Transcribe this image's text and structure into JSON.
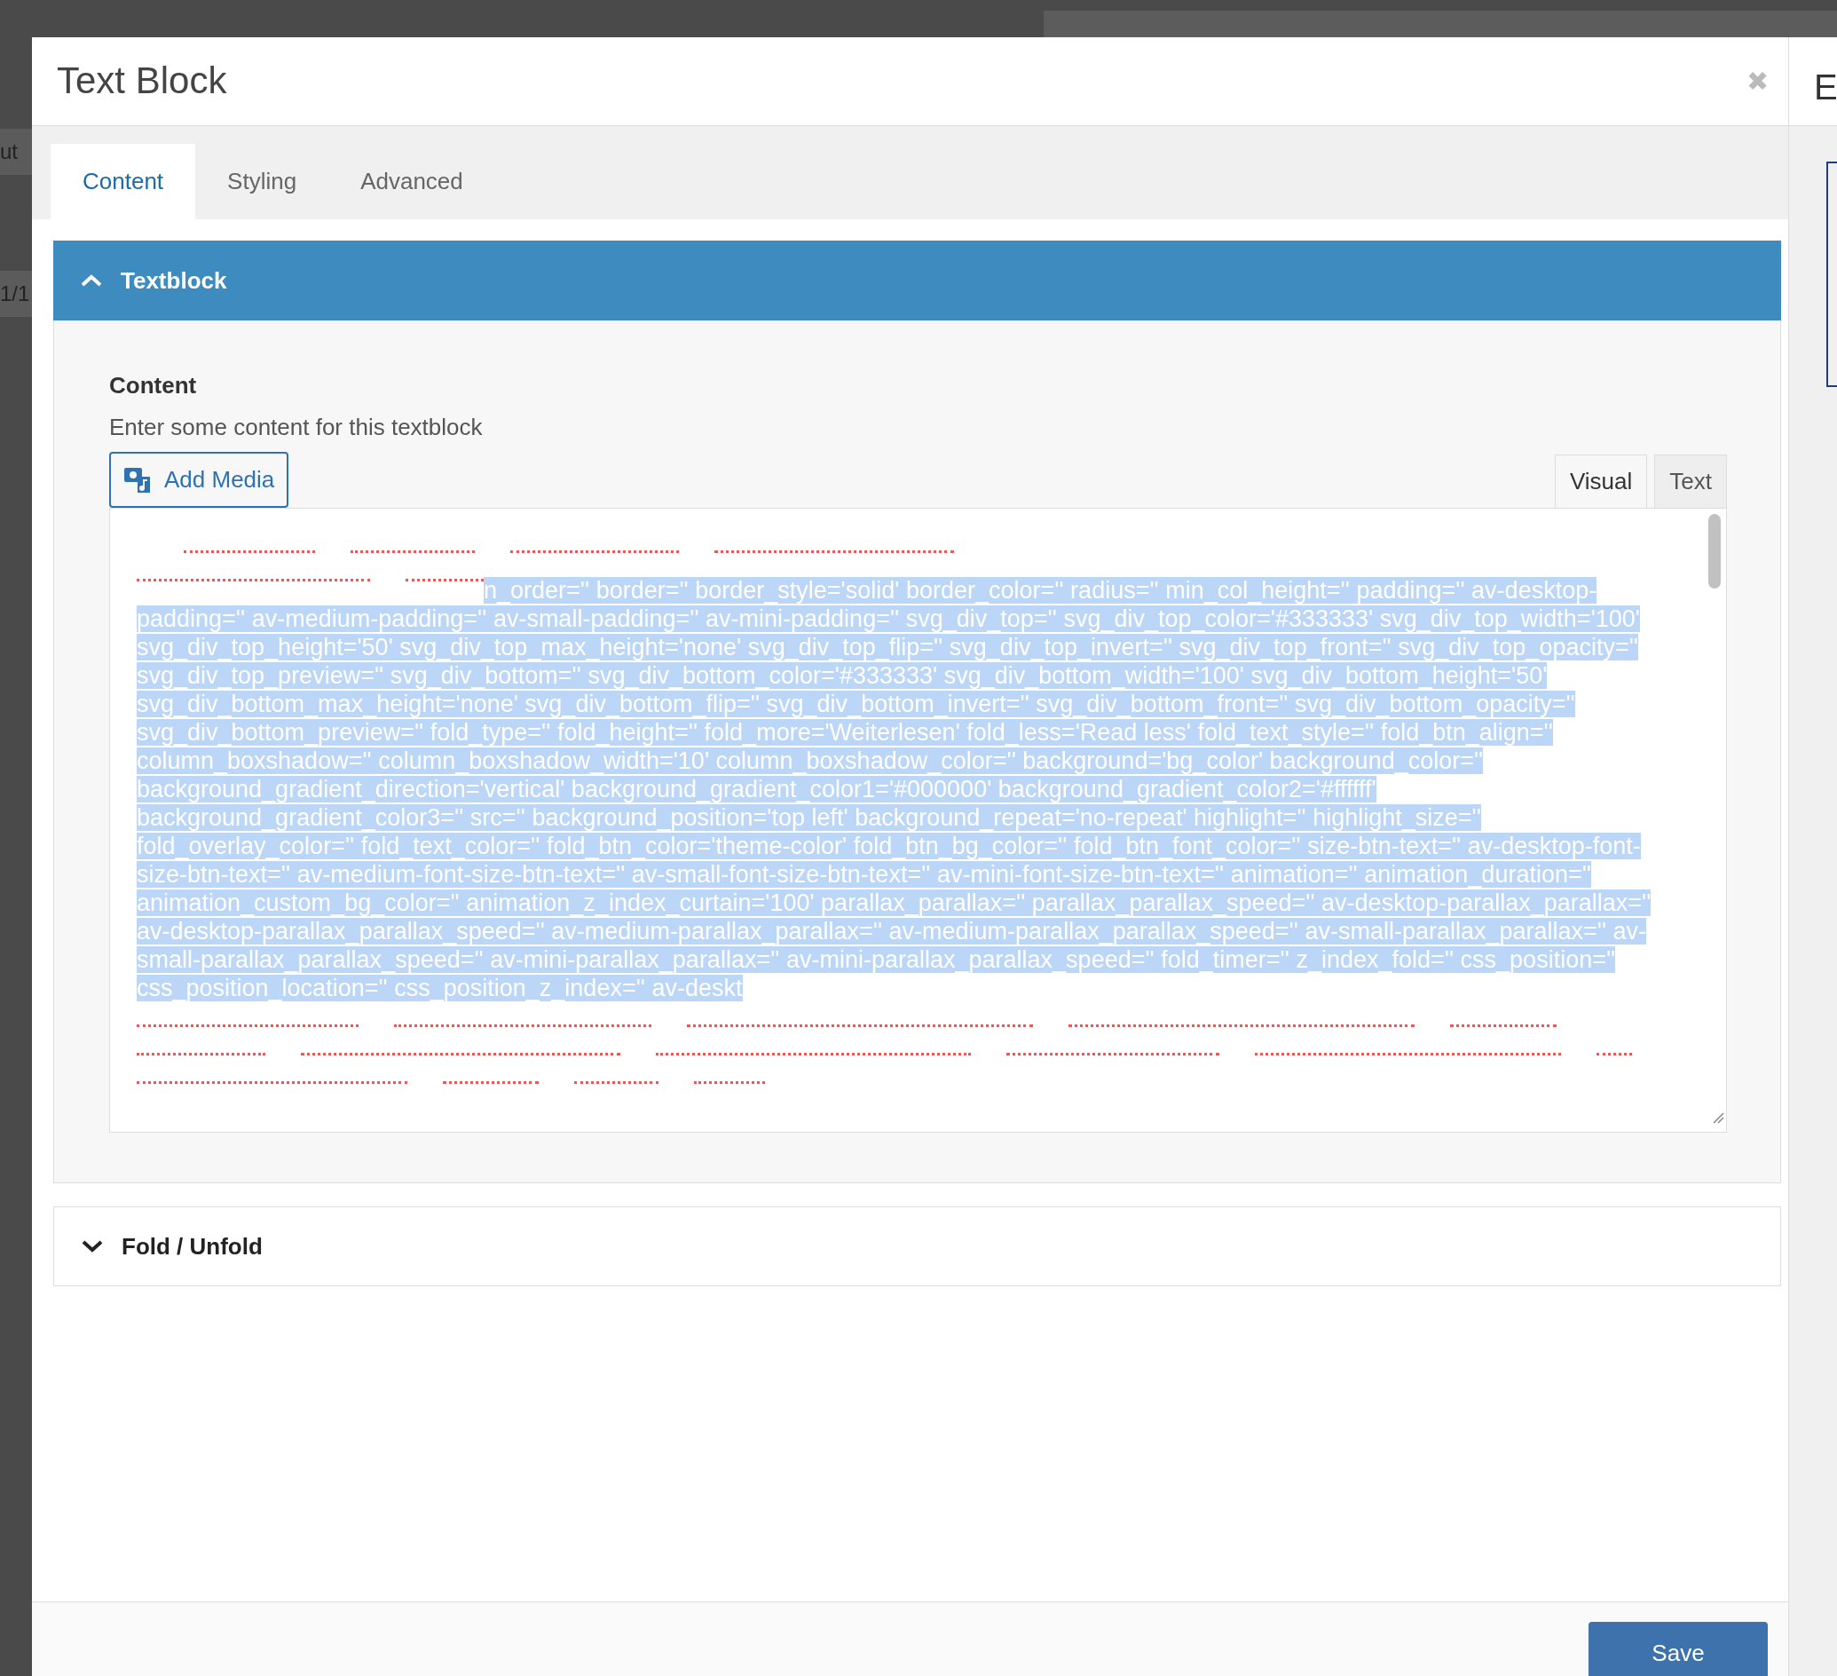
{
  "background": {
    "left_texts": [
      "ut",
      "1/1"
    ],
    "right_text": "E"
  },
  "window": {
    "title": "Text Block",
    "close": "✖"
  },
  "tabs": [
    {
      "label": "Content",
      "selected": true
    },
    {
      "label": "Styling",
      "selected": false
    },
    {
      "label": "Advanced",
      "selected": false
    }
  ],
  "sections": [
    {
      "title": "Textblock",
      "expanded": true
    },
    {
      "title": "Fold / Unfold",
      "expanded": false
    }
  ],
  "field": {
    "label": "Content",
    "description": "Enter some content for this textblock",
    "add_media": "Add Media",
    "editor_tabs": [
      {
        "label": "Visual",
        "selected": true
      },
      {
        "label": "Text",
        "selected": false
      }
    ],
    "selected_lines": [
      "n_order='' border='' border_style='solid' border_color='' radius='' min_col_height='' padding='' av-desktop-",
      "padding='' av-medium-padding='' av-small-padding='' av-mini-padding='' svg_div_top='' svg_div_top_color='#333333' svg_div_top_width='100'",
      "svg_div_top_height='50' svg_div_top_max_height='none' svg_div_top_flip='' svg_div_top_invert='' svg_div_top_front='' svg_div_top_opacity=''",
      "svg_div_top_preview='' svg_div_bottom='' svg_div_bottom_color='#333333' svg_div_bottom_width='100' svg_div_bottom_height='50'",
      "svg_div_bottom_max_height='none' svg_div_bottom_flip='' svg_div_bottom_invert='' svg_div_bottom_front='' svg_div_bottom_opacity=''",
      "svg_div_bottom_preview='' fold_type='' fold_height='' fold_more='Weiterlesen' fold_less='Read less' fold_text_style='' fold_btn_align=''",
      "column_boxshadow='' column_boxshadow_width='10' column_boxshadow_color='' background='bg_color' background_color=''",
      "background_gradient_direction='vertical' background_gradient_color1='#000000' background_gradient_color2='#ffffff'",
      "background_gradient_color3='' src='' background_position='top left' background_repeat='no-repeat' highlight='' highlight_size=''",
      "fold_overlay_color='' fold_text_color='' fold_btn_color='theme-color' fold_btn_bg_color='' fold_btn_font_color='' size-btn-text='' av-desktop-font-",
      "size-btn-text='' av-medium-font-size-btn-text='' av-small-font-size-btn-text='' av-mini-font-size-btn-text='' animation='' animation_duration=''",
      "animation_custom_bg_color='' animation_z_index_curtain='100' parallax_parallax='' parallax_parallax_speed='' av-desktop-parallax_parallax=''",
      "av-desktop-parallax_parallax_speed='' av-medium-parallax_parallax='' av-medium-parallax_parallax_speed='' av-small-parallax_parallax='' av-",
      "small-parallax_parallax_speed='' av-mini-parallax_parallax='' av-mini-parallax_parallax_speed='' fold_timer='' z_index_fold='' css_position=''",
      "css_position_location='' css_position_z_index='' av-deskt"
    ]
  },
  "footer": {
    "save": "Save"
  }
}
